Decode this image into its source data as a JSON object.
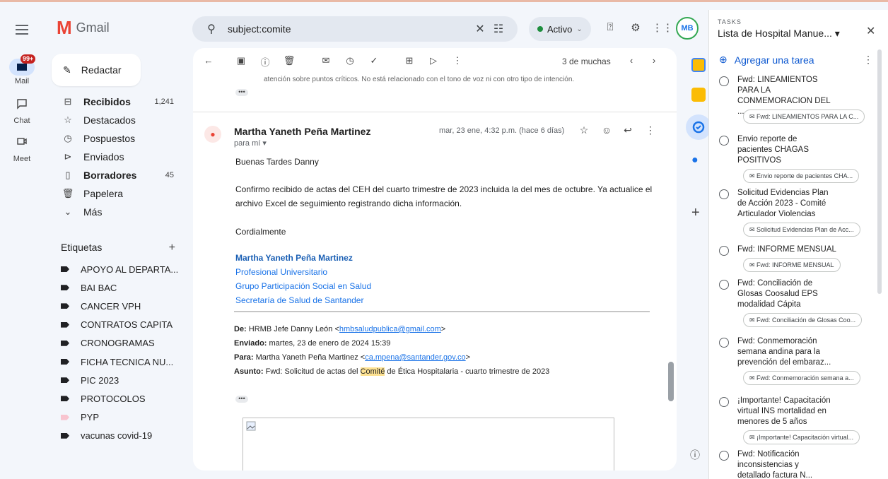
{
  "rail": {
    "mail_label": "Mail",
    "badge": "99+",
    "chat_label": "Chat",
    "meet_label": "Meet"
  },
  "logo": {
    "text": "Gmail"
  },
  "search": {
    "value": "subject:comite"
  },
  "status": {
    "label": "Activo"
  },
  "avatar": {
    "initials": "MB"
  },
  "compose": {
    "label": "Redactar"
  },
  "nav": [
    {
      "label": "Recibidos",
      "count": "1,241",
      "icon": "inbox-icon",
      "bold": true
    },
    {
      "label": "Destacados",
      "count": "",
      "icon": "star-icon",
      "bold": false
    },
    {
      "label": "Pospuestos",
      "count": "",
      "icon": "clock-icon",
      "bold": false
    },
    {
      "label": "Enviados",
      "count": "",
      "icon": "send-icon",
      "bold": false
    },
    {
      "label": "Borradores",
      "count": "45",
      "icon": "draft-icon",
      "bold": true
    },
    {
      "label": "Papelera",
      "count": "",
      "icon": "trash-icon",
      "bold": false
    },
    {
      "label": "Más",
      "count": "",
      "icon": "chevron-down-icon",
      "bold": false
    }
  ],
  "labels": {
    "heading": "Etiquetas",
    "items": [
      "APOYO AL DEPARTA...",
      "BAI BAC",
      "CANCER VPH",
      "CONTRATOS CAPITA",
      "CRONOGRAMAS",
      "FICHA TECNICA NU...",
      "PIC 2023",
      "PROTOCOLOS",
      "PYP",
      "vacunas covid-19"
    ],
    "colors": [
      "#202124",
      "#202124",
      "#202124",
      "#202124",
      "#202124",
      "#202124",
      "#202124",
      "#202124",
      "#f8c4cf",
      "#202124"
    ]
  },
  "toolbar": {
    "pager": "3 de muchas"
  },
  "message": {
    "prev_text": "atención sobre puntos críticos. No está relacionado con el tono de voz ni con otro tipo de intención.",
    "sender": "Martha Yaneth Peña Martinez",
    "to": "para mí ▾",
    "date": "mar, 23 ene, 4:32 p.m. (hace 6 días)",
    "greeting": "Buenas Tardes Danny",
    "body_line1": "Confirmo recibido de actas del CEH del cuarto trimestre de 2023 incluida la del mes de octubre.  Ya actualice el",
    "body_line2": "archivo Excel de seguimiento registrando dicha información.",
    "closing": "Cordialmente",
    "sig_name": "Martha Yaneth Peña Martinez",
    "sig_role": "Profesional Universitario",
    "sig_group": "Grupo Participación Social en Salud",
    "sig_org": "Secretaría de Salud de Santander",
    "fw_de_label": "De:",
    "fw_de": "HRMB Jefe Danny León <",
    "fw_de_email": "hmbsaludpublica@gmail.com",
    "fw_de_end": ">",
    "fw_env_label": "Enviado:",
    "fw_env": "martes, 23 de enero de 2024 15:39",
    "fw_para_label": "Para:",
    "fw_para": "Martha Yaneth Peña Martinez <",
    "fw_para_email": "ca.mpena@santander.gov.co",
    "fw_para_end": ">",
    "fw_asunto_label": "Asunto:",
    "fw_asunto_pre": "Fwd: Solicitud de actas del ",
    "fw_asunto_hl": "Comité",
    "fw_asunto_post": " de Ética Hospitalaria - cuarto trimestre de 2023"
  },
  "tasks": {
    "header": "TASKS",
    "list": "Lista de Hospital Manue... ▾",
    "add": "Agregar una tarea",
    "items": [
      {
        "l1": "Fwd: LINEAMIENTOS",
        "l2": "PARA LA",
        "l3": "CONMEMORACION DEL ...",
        "chip": "Fwd: LINEAMIENTOS PARA LA C..."
      },
      {
        "l1": "Envio reporte de",
        "l2": "pacientes CHAGAS",
        "l3": "POSITIVOS",
        "chip": "Envio reporte de pacientes CHA..."
      },
      {
        "l1": "Solicitud Evidencias Plan",
        "l2": "de Acción 2023 - Comité",
        "l3": "Articulador Violencias",
        "chip": "Solicitud Evidencias Plan de Acc..."
      },
      {
        "l1": "Fwd: INFORME MENSUAL",
        "l2": "",
        "l3": "",
        "chip": "Fwd: INFORME MENSUAL"
      },
      {
        "l1": "Fwd: Conciliación de",
        "l2": "Glosas Coosalud EPS",
        "l3": "modalidad Cápita",
        "chip": "Fwd: Conciliación de Glosas Coo..."
      },
      {
        "l1": "Fwd: Conmemoración",
        "l2": "semana andina para la",
        "l3": "prevención del embaraz...",
        "chip": "Fwd: Conmemoración semana a..."
      },
      {
        "l1": "¡Importante! Capacitación",
        "l2": "virtual INS mortalidad en",
        "l3": "menores de 5 años",
        "chip": "¡Importante! Capacitación virtual..."
      },
      {
        "l1": "Fwd: Notificación",
        "l2": "inconsistencias y",
        "l3": "detallado factura N...",
        "chip": ""
      }
    ]
  }
}
